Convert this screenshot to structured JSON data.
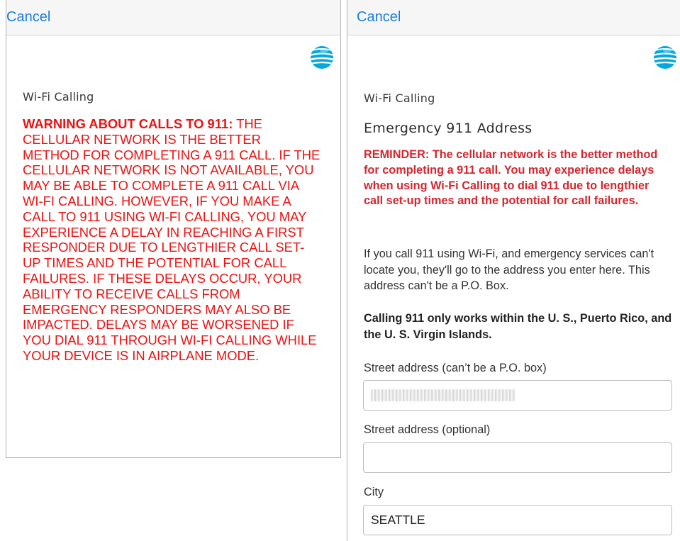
{
  "left_screen": {
    "cancel_label": "Cancel",
    "section_label": "Wi-Fi Calling",
    "warning_heading": "WARNING ABOUT CALLS TO 911:",
    "warning_body": " THE CELLULAR NETWORK IS THE BETTER METHOD FOR COMPLETING A 911 CALL. IF THE CELLULAR NETWORK IS NOT AVAILABLE, YOU MAY BE ABLE TO COMPLETE A 911 CALL VIA WI-FI CALLING. HOWEVER, IF YOU MAKE A CALL TO 911 USING WI-FI CALLING, YOU MAY EXPERIENCE A DELAY IN REACHING A FIRST RESPONDER DUE TO LENGTHIER CALL SET-UP TIMES AND THE POTENTIAL FOR CALL FAILURES. IF THESE DELAYS OCCUR, YOUR ABILITY TO RECEIVE CALLS FROM EMERGENCY RESPONDERS MAY ALSO BE IMPACTED. DELAYS MAY BE WORSENED IF YOU DIAL 911 THROUGH WI-FI CALLING WHILE YOUR DEVICE IS IN AIRPLANE MODE."
  },
  "right_screen": {
    "cancel_label": "Cancel",
    "section_label": "Wi-Fi Calling",
    "title": "Emergency 911 Address",
    "reminder": "REMINDER: The cellular network is the better method for completing a 911 call. You may experience delays when using Wi-Fi Calling to dial 911 due to lengthier call set-up times and the potential for call failures.",
    "info": "If you call 911 using Wi-Fi, and emergency services can't locate you, they'll go to the address you enter here. This address can't be a P.O. Box.",
    "coverage_note": "Calling 911 only works within the U. S., Puerto Rico, and the U. S. Virgin Islands.",
    "fields": {
      "street1_label": "Street address (can’t be a P.O. box)",
      "street1_value": "",
      "street2_label": "Street address (optional)",
      "street2_value": "",
      "city_label": "City",
      "city_value": "SEATTLE"
    }
  },
  "colors": {
    "link_blue": "#1a7fe3",
    "warning_red": "#ee1111",
    "reminder_red": "#d5262e",
    "header_bg": "#f6f6f7",
    "att_blue": "#00a8e0"
  },
  "icons": {
    "logo": "att-globe-logo"
  }
}
